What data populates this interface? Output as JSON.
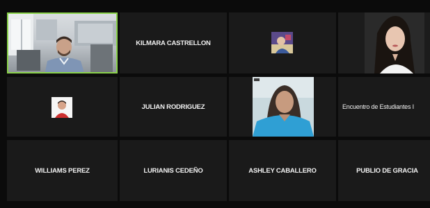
{
  "participants": [
    {
      "name": "KILMARA CASTRELLON"
    },
    {
      "name": "JULIAN RODRIGUEZ"
    },
    {
      "name": "Encuentro de Estudiantes I"
    },
    {
      "name": "WILLIAMS PEREZ"
    },
    {
      "name": "LURIANIS CEDEÑO"
    },
    {
      "name": "ASHLEY CABALLERO"
    },
    {
      "name": "PUBLIO DE GRACIA"
    }
  ],
  "colors": {
    "active_speaker_border": "#8ad24a",
    "tile_background": "#1a1a1a",
    "screen_background": "#0b0b0b"
  }
}
